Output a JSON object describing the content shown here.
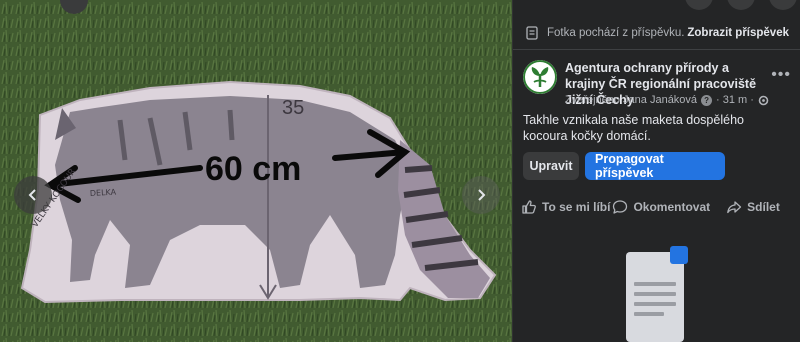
{
  "viewer": {
    "prev_icon": "chevron-left-icon",
    "next_icon": "chevron-right-icon",
    "photo_labels": {
      "measure_main": "60 cm",
      "measure_height": "35",
      "scribble_delka": "DELKA",
      "scribble_kocour": "VELKY KOCOUR"
    }
  },
  "panel": {
    "source_text": "Fotka pochází z příspěvku.",
    "show_post": "Zobrazit příspěvek",
    "page_name": "Agentura ochrany přírody a krajiny ČR regionální pracoviště Jižní Čechy",
    "meta_prefix": "Zveřejněno",
    "meta_author": "Jana Janáková",
    "meta_time": "· 31 m ·",
    "more_icon": "more-horizontal-icon",
    "post_text": "Takhle vznikala naše maketa dospělého kocoura kočky domácí.",
    "edit_label": "Upravit",
    "promote_label": "Propagovat příspěvek",
    "like_label": "To se mi líbí",
    "comment_label": "Okomentovat",
    "share_label": "Sdílet"
  },
  "colors": {
    "panel_bg": "#242526",
    "primary_text": "#e4e6eb",
    "secondary_text": "#b0b3b8",
    "button_secondary": "#3a3b3c",
    "button_primary": "#2374e1",
    "logo_green": "#2e7d32"
  }
}
